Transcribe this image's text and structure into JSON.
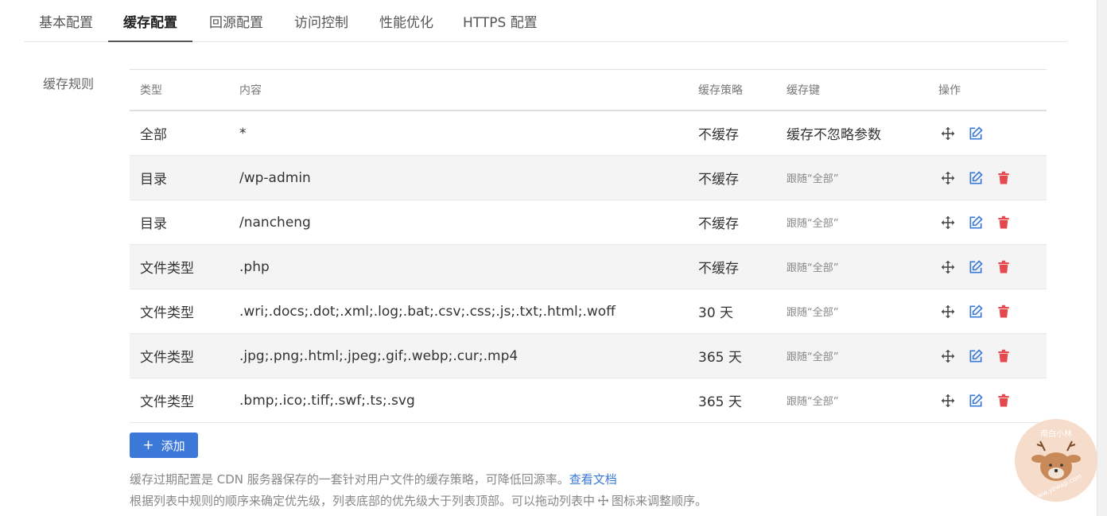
{
  "tabs": [
    {
      "label": "基本配置",
      "active": false
    },
    {
      "label": "缓存配置",
      "active": true
    },
    {
      "label": "回源配置",
      "active": false
    },
    {
      "label": "访问控制",
      "active": false
    },
    {
      "label": "性能优化",
      "active": false
    },
    {
      "label": "HTTPS 配置",
      "active": false
    }
  ],
  "section_label": "缓存规则",
  "table": {
    "headers": {
      "type": "类型",
      "content": "内容",
      "policy": "缓存策略",
      "key": "缓存键",
      "ops": "操作"
    },
    "rows": [
      {
        "type": "全部",
        "content": "*",
        "policy": "不缓存",
        "key": "缓存不忽略参数",
        "deletable": false
      },
      {
        "type": "目录",
        "content": "/wp-admin",
        "policy": "不缓存",
        "key": "跟随“全部”",
        "deletable": true
      },
      {
        "type": "目录",
        "content": "/nancheng",
        "policy": "不缓存",
        "key": "跟随“全部”",
        "deletable": true
      },
      {
        "type": "文件类型",
        "content": ".php",
        "policy": "不缓存",
        "key": "跟随“全部”",
        "deletable": true
      },
      {
        "type": "文件类型",
        "content": ".wri;.docs;.dot;.xml;.log;.bat;.csv;.css;.js;.txt;.html;.woff",
        "policy": "30 天",
        "key": "跟随“全部”",
        "deletable": true
      },
      {
        "type": "文件类型",
        "content": ".jpg;.png;.html;.jpeg;.gif;.webp;.cur;.mp4",
        "policy": "365 天",
        "key": "跟随“全部”",
        "deletable": true
      },
      {
        "type": "文件类型",
        "content": ".bmp;.ico;.tiff;.swf;.ts;.svg",
        "policy": "365 天",
        "key": "跟随“全部”",
        "deletable": true
      }
    ]
  },
  "add_button": {
    "label": "添加"
  },
  "notes": {
    "line1": "缓存过期配置是 CDN 服务器保存的一套针对用户文件的缓存策略，可降低回源率。",
    "line1_link": "查看文档",
    "line2_before": "根据列表中规则的顺序来确定优先级，列表底部的优先级大于列表顶部。可以拖动列表中",
    "line2_after": "图标来调整顺序。"
  },
  "watermark": {
    "top_text": "南白小林",
    "bottom_text": "www.yowap.com"
  },
  "icons": {
    "move": "move-icon",
    "edit": "edit-icon",
    "delete": "trash-icon"
  },
  "colors": {
    "accent": "#3c78d8",
    "danger": "#e5484d",
    "icon": "#444444"
  }
}
